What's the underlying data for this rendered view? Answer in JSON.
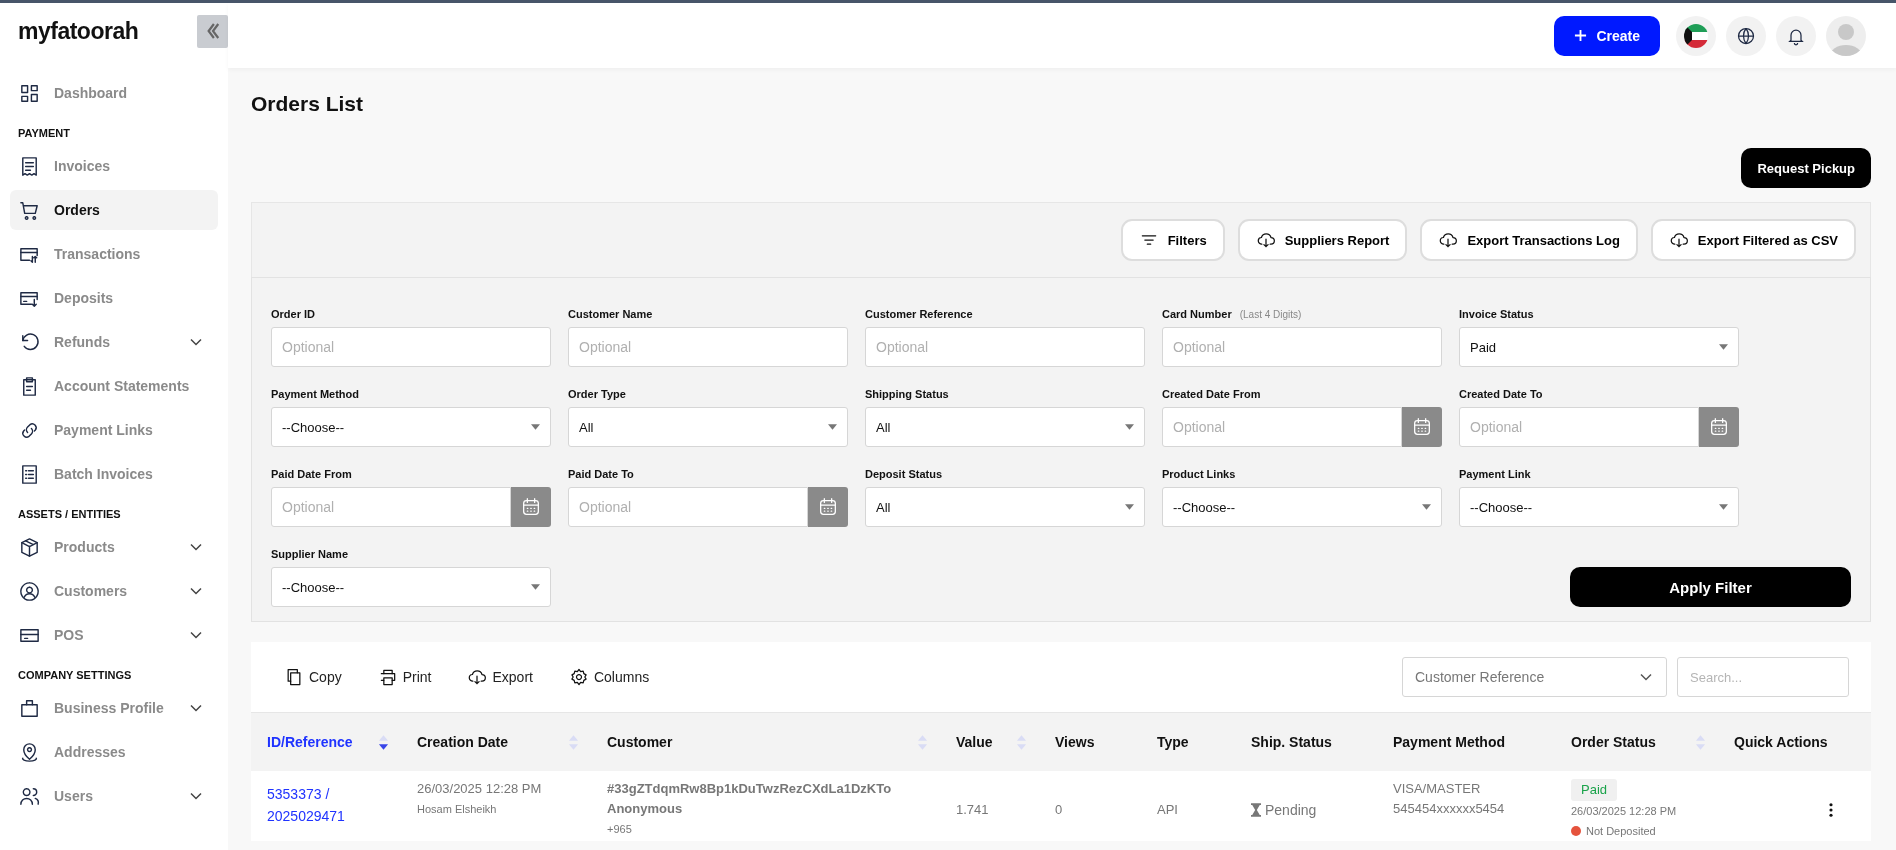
{
  "logo": "myfatoorah",
  "sidebar": {
    "sections": [
      {
        "items": [
          {
            "label": "Dashboard",
            "kind": "grid",
            "selected": false,
            "expandable": false
          }
        ]
      },
      {
        "heading": "PAYMENT",
        "items": [
          {
            "label": "Invoices",
            "kind": "receipt",
            "selected": false,
            "expandable": false
          },
          {
            "label": "Orders",
            "kind": "cart",
            "selected": true,
            "expandable": false
          },
          {
            "label": "Transactions",
            "kind": "card-arrows",
            "selected": false,
            "expandable": false
          },
          {
            "label": "Deposits",
            "kind": "card-down",
            "selected": false,
            "expandable": false
          },
          {
            "label": "Refunds",
            "kind": "refresh",
            "selected": false,
            "expandable": true
          },
          {
            "label": "Account Statements",
            "kind": "clipboard",
            "selected": false,
            "expandable": false
          },
          {
            "label": "Payment Links",
            "kind": "link",
            "selected": false,
            "expandable": false
          },
          {
            "label": "Batch Invoices",
            "kind": "list",
            "selected": false,
            "expandable": false
          }
        ]
      },
      {
        "heading": "ASSETS / ENTITIES",
        "items": [
          {
            "label": "Products",
            "kind": "box",
            "selected": false,
            "expandable": true
          },
          {
            "label": "Customers",
            "kind": "user-circle",
            "selected": false,
            "expandable": true
          },
          {
            "label": "POS",
            "kind": "card",
            "selected": false,
            "expandable": true
          }
        ]
      },
      {
        "heading": "COMPANY SETTINGS",
        "items": [
          {
            "label": "Business Profile",
            "kind": "bag",
            "selected": false,
            "expandable": true
          },
          {
            "label": "Addresses",
            "kind": "pin",
            "selected": false,
            "expandable": false
          },
          {
            "label": "Users",
            "kind": "users",
            "selected": false,
            "expandable": true
          }
        ]
      }
    ]
  },
  "header": {
    "create_button": "Create"
  },
  "page_title": "Orders List",
  "request_pickup": "Request Pickup",
  "toolbar": [
    {
      "label": "Filters",
      "kind": "filter"
    },
    {
      "label": "Suppliers Report",
      "kind": "cloud"
    },
    {
      "label": "Export Transactions Log",
      "kind": "cloud"
    },
    {
      "label": "Export Filtered as CSV",
      "kind": "cloud"
    }
  ],
  "filters": [
    {
      "label": "Order ID",
      "kind": "text",
      "placeholder": "Optional"
    },
    {
      "label": "Customer Name",
      "kind": "text",
      "placeholder": "Optional"
    },
    {
      "label": "Customer Reference",
      "kind": "text",
      "placeholder": "Optional"
    },
    {
      "label": "Card Number",
      "hint": "(Last 4 Digits)",
      "kind": "text",
      "placeholder": "Optional"
    },
    {
      "label": "Invoice Status",
      "kind": "select",
      "value": "Paid"
    },
    {
      "label": "Payment Method",
      "kind": "select",
      "value": "--Choose--"
    },
    {
      "label": "Order Type",
      "kind": "select",
      "value": "All"
    },
    {
      "label": "Shipping Status",
      "kind": "select",
      "value": "All"
    },
    {
      "label": "Created Date From",
      "kind": "date",
      "placeholder": "Optional"
    },
    {
      "label": "Created Date To",
      "kind": "date",
      "placeholder": "Optional"
    },
    {
      "label": "Paid Date From",
      "kind": "date",
      "placeholder": "Optional"
    },
    {
      "label": "Paid Date To",
      "kind": "date",
      "placeholder": "Optional"
    },
    {
      "label": "Deposit Status",
      "kind": "select",
      "value": "All"
    },
    {
      "label": "Product Links",
      "kind": "select",
      "value": "--Choose--"
    },
    {
      "label": "Payment Link",
      "kind": "select",
      "value": "--Choose--"
    },
    {
      "label": "Supplier Name",
      "kind": "select",
      "value": "--Choose--"
    }
  ],
  "apply_filter": "Apply Filter",
  "table": {
    "tools": [
      {
        "label": "Copy",
        "kind": "copy"
      },
      {
        "label": "Print",
        "kind": "print"
      },
      {
        "label": "Export",
        "kind": "cloud"
      },
      {
        "label": "Columns",
        "kind": "gear"
      }
    ],
    "search_by": "Customer Reference",
    "search": {
      "placeholder": "Search..."
    },
    "columns": [
      {
        "label": "ID/Reference",
        "sortable": true,
        "active": true
      },
      {
        "label": "Creation Date",
        "sortable": true,
        "active": false
      },
      {
        "label": "Customer",
        "sortable": true,
        "active": false
      },
      {
        "label": "Value",
        "sortable": true,
        "active": false
      },
      {
        "label": "Views",
        "sortable": false,
        "active": false
      },
      {
        "label": "Type",
        "sortable": false,
        "active": false
      },
      {
        "label": "Ship. Status",
        "sortable": false,
        "active": false
      },
      {
        "label": "Payment Method",
        "sortable": false,
        "active": false
      },
      {
        "label": "Order Status",
        "sortable": true,
        "active": false
      },
      {
        "label": "Quick Actions",
        "sortable": false,
        "active": false
      }
    ],
    "rows": [
      {
        "id": "5353373 / 2025029471",
        "date": "26/03/2025 12:28 PM",
        "created_by": "Hosam Elsheikh",
        "customer_ref": "#33gZTdqmRw8Bp1kDuTwzRezCXdLa1DzKTo",
        "customer_name": "Anonymous",
        "phone": "+965",
        "value": "1.741",
        "views": "0",
        "type": "API",
        "ship_status": "Pending",
        "payment_method": "VISA/MASTER",
        "card": "545454xxxxxx5454",
        "order_status": "Paid",
        "status_date": "26/03/2025 12:28 PM",
        "deposit_status": "Not Deposited"
      }
    ]
  }
}
